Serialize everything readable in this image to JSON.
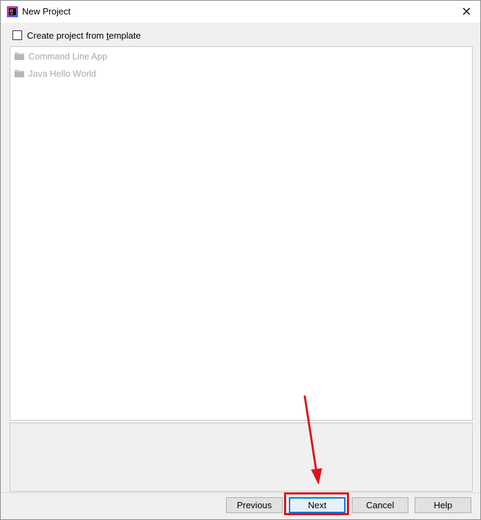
{
  "window": {
    "title": "New Project",
    "close_glyph": "✕"
  },
  "template_option": {
    "label_prefix": "Create project from ",
    "label_mnemonic": "t",
    "label_suffix": "emplate",
    "checked": false
  },
  "templates": [
    {
      "label": "Command Line App",
      "icon": "folder-icon",
      "enabled": false
    },
    {
      "label": "Java Hello World",
      "icon": "folder-icon",
      "enabled": false
    }
  ],
  "buttons": {
    "previous": "Previous",
    "next": "Next",
    "cancel": "Cancel",
    "help": "Help"
  },
  "colors": {
    "highlight": "#d9141c",
    "focus_border": "#0078d7"
  }
}
